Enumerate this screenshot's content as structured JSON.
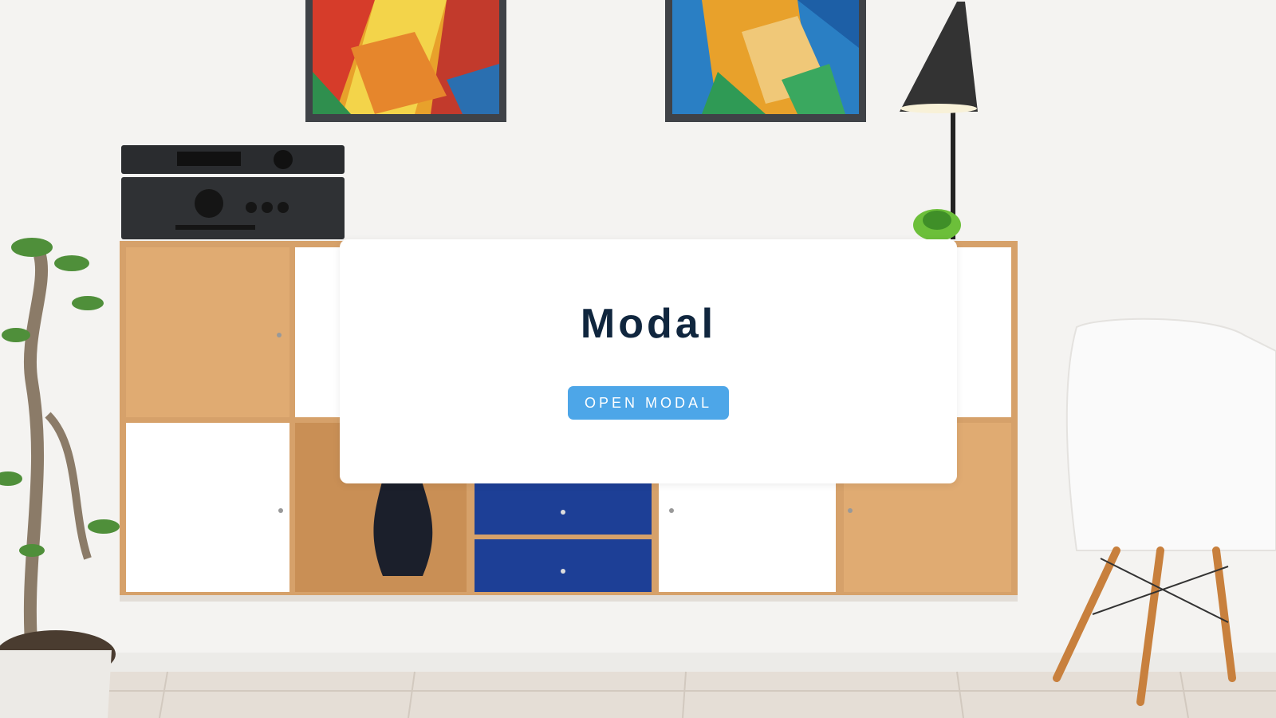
{
  "modal_card": {
    "title": "Modal",
    "open_button_label": "OPEN MODAL"
  },
  "colors": {
    "title": "#10263e",
    "button": "#4da6e8",
    "card": "#ffffff",
    "wall": "#f4f3f1"
  },
  "icons": {
    "background": "living-room-photo"
  }
}
